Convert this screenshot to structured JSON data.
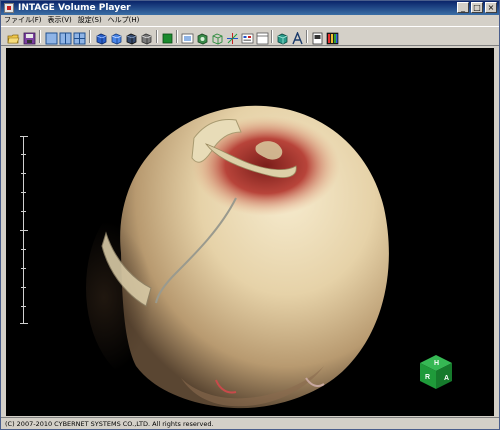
{
  "window": {
    "title": "INTAGE Volume Player"
  },
  "menu": {
    "items": [
      "ファイル(F)",
      "表示(V)",
      "設定(S)",
      "ヘルプ(H)"
    ]
  },
  "toolbar": {
    "buttons": [
      "open-icon",
      "save-icon",
      "layout-single-icon",
      "layout-dual-icon",
      "layout-quad-icon",
      "cube-blue-solid-icon",
      "cube-blue-icon",
      "cube-dark-icon",
      "cube-gray-icon",
      "green-square-icon",
      "screenshot-icon",
      "render-cube-icon",
      "wireframe-cube-icon",
      "axes-icon",
      "mpr-icon",
      "panel-icon",
      "object-cube-icon",
      "annotation-icon",
      "page-icon",
      "palette-icon"
    ]
  },
  "orientation_cube": {
    "top": "H",
    "left": "R",
    "right": "A",
    "color": "#1f9a3a"
  },
  "status": {
    "copyright": "(C) 2007-2010 CYBERNET SYSTEMS CO.,LTD. All rights reserved."
  }
}
